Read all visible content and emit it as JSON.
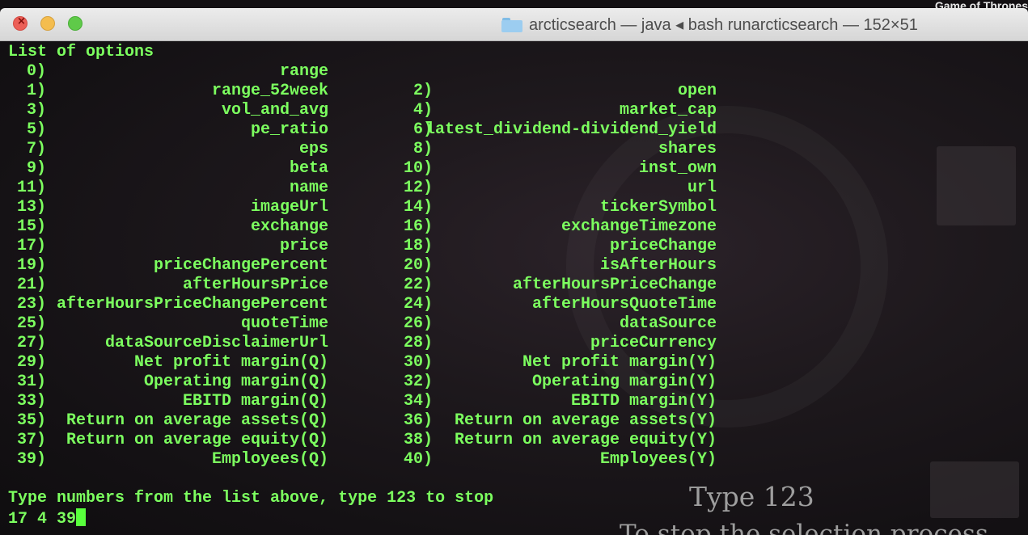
{
  "window": {
    "title": "arcticsearch — java ◂ bash runarcticsearch — 152×51",
    "background_peek_text": "Game of Thrones"
  },
  "terminal": {
    "heading": "List of options",
    "options": [
      {
        "n": "0)",
        "label": "range"
      },
      {
        "n": "1)",
        "label": "range_52week"
      },
      {
        "n": "2)",
        "label": "open"
      },
      {
        "n": "3)",
        "label": "vol_and_avg"
      },
      {
        "n": "4)",
        "label": "market_cap"
      },
      {
        "n": "5)",
        "label": "pe_ratio"
      },
      {
        "n": "6)",
        "label": "latest_dividend-dividend_yield"
      },
      {
        "n": "7)",
        "label": "eps"
      },
      {
        "n": "8)",
        "label": "shares"
      },
      {
        "n": "9)",
        "label": "beta"
      },
      {
        "n": "10)",
        "label": "inst_own"
      },
      {
        "n": "11)",
        "label": "name"
      },
      {
        "n": "12)",
        "label": "url"
      },
      {
        "n": "13)",
        "label": "imageUrl"
      },
      {
        "n": "14)",
        "label": "tickerSymbol"
      },
      {
        "n": "15)",
        "label": "exchange"
      },
      {
        "n": "16)",
        "label": "exchangeTimezone"
      },
      {
        "n": "17)",
        "label": "price"
      },
      {
        "n": "18)",
        "label": "priceChange"
      },
      {
        "n": "19)",
        "label": "priceChangePercent"
      },
      {
        "n": "20)",
        "label": "isAfterHours"
      },
      {
        "n": "21)",
        "label": "afterHoursPrice"
      },
      {
        "n": "22)",
        "label": "afterHoursPriceChange"
      },
      {
        "n": "23)",
        "label": "afterHoursPriceChangePercent"
      },
      {
        "n": "24)",
        "label": "afterHoursQuoteTime"
      },
      {
        "n": "25)",
        "label": "quoteTime"
      },
      {
        "n": "26)",
        "label": "dataSource"
      },
      {
        "n": "27)",
        "label": "dataSourceDisclaimerUrl"
      },
      {
        "n": "28)",
        "label": "priceCurrency"
      },
      {
        "n": "29)",
        "label": "Net profit margin(Q)"
      },
      {
        "n": "30)",
        "label": "Net profit margin(Y)"
      },
      {
        "n": "31)",
        "label": "Operating margin(Q)"
      },
      {
        "n": "32)",
        "label": "Operating margin(Y)"
      },
      {
        "n": "33)",
        "label": "EBITD margin(Q)"
      },
      {
        "n": "34)",
        "label": "EBITD margin(Y)"
      },
      {
        "n": "35)",
        "label": "Return on average assets(Q)"
      },
      {
        "n": "36)",
        "label": "Return on average assets(Y)"
      },
      {
        "n": "37)",
        "label": "Return on average equity(Q)"
      },
      {
        "n": "38)",
        "label": "Return on average equity(Y)"
      },
      {
        "n": "39)",
        "label": "Employees(Q)"
      },
      {
        "n": "40)",
        "label": "Employees(Y)"
      }
    ],
    "prompt": "Type numbers from the list above, type 123 to stop",
    "input": "17 4 39"
  },
  "overlay": {
    "caption_main": "Type 123",
    "caption_sub": "To stop the selection process"
  },
  "colors": {
    "terminal_text": "#7cff5f",
    "cursor": "#58ff3c",
    "caption": "#9e9e9e"
  }
}
